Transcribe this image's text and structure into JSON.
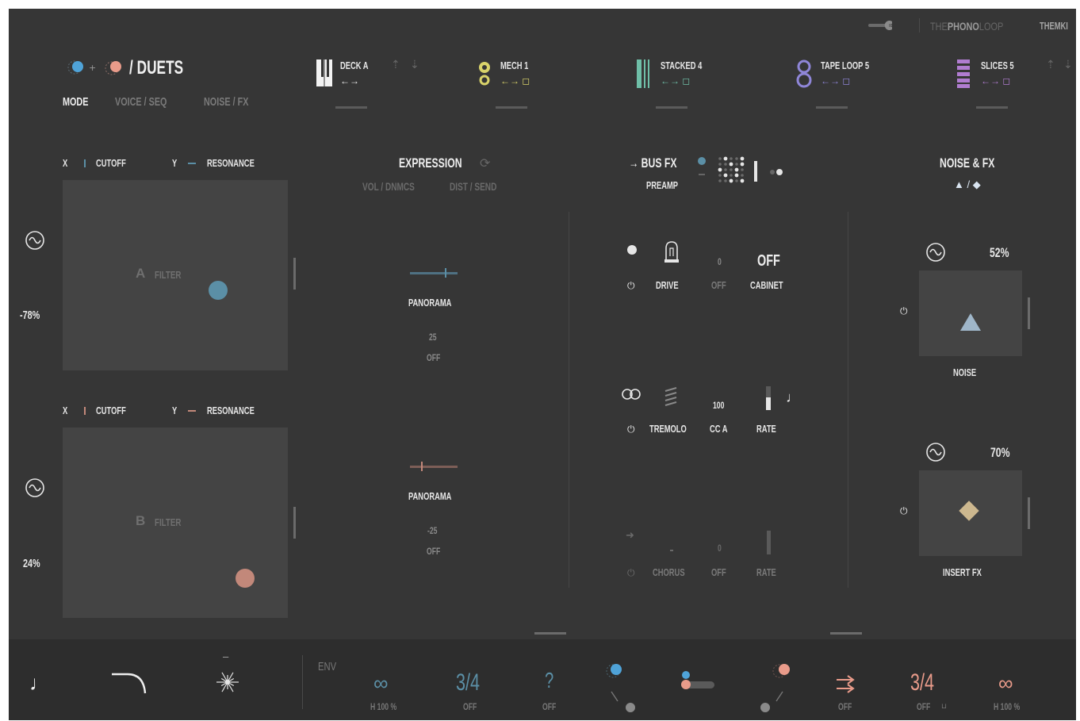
{
  "brand": {
    "wrench_icon": "wrench-icon",
    "name_the": "THE",
    "name_phono": "PHONO",
    "name_loop": "LOOP",
    "name_user": "THEMKI"
  },
  "colors": {
    "blue": "#5b8fa6",
    "salmon": "#c2887a",
    "yellow": "#d9d36a",
    "teal": "#6fbfa8",
    "purple": "#b07cd0",
    "lavender": "#8f86d8",
    "bg": "#363636"
  },
  "header": {
    "title": "/ DUETS",
    "tabs": [
      {
        "label": "MODE",
        "active": true
      },
      {
        "label": "VOICE / SEQ",
        "active": false
      },
      {
        "label": "NOISE / FX",
        "active": false
      }
    ]
  },
  "decks": [
    {
      "name": "DECK A",
      "icon": "piano-icon"
    },
    {
      "name": "MECH 1",
      "icon": "gear-icon"
    },
    {
      "name": "STACKED 4",
      "icon": "bars-icon"
    },
    {
      "name": "TAPE LOOP 5",
      "icon": "tape-loop-icon"
    },
    {
      "name": "SLICES 5",
      "icon": "slices-icon"
    }
  ],
  "pads": [
    {
      "x_label": "X",
      "x_param": "CUTOFF",
      "y_label": "Y",
      "y_param": "RESONANCE",
      "letter": "A",
      "name": "FILTER",
      "lfo_value": "-78%"
    },
    {
      "x_label": "X",
      "x_param": "CUTOFF",
      "y_label": "Y",
      "y_param": "RESONANCE",
      "letter": "B",
      "name": "FILTER",
      "lfo_value": "24%"
    }
  ],
  "expression": {
    "title": "EXPRESSION",
    "sub_left": "VOL / DNMCS",
    "sub_right": "DIST / SEND",
    "voices": [
      {
        "label": "PANORAMA",
        "value": "25",
        "state": "OFF"
      },
      {
        "label": "PANORAMA",
        "value": "-25",
        "state": "OFF"
      }
    ]
  },
  "busfx": {
    "title": "→ BUS FX",
    "sub": "PREAMP",
    "rows": [
      {
        "name": "DRIVE",
        "value": "0",
        "value_state": "OFF",
        "extra_value": "OFF",
        "extra_label": "CABINET"
      },
      {
        "name": "TREMOLO",
        "value": "100",
        "value_state": "CC A",
        "extra_label": "RATE"
      },
      {
        "name": "CHORUS",
        "value": "0",
        "value_state": "OFF",
        "extra_label": "RATE"
      }
    ]
  },
  "noisefx": {
    "title": "NOISE & FX",
    "sub": "▲ / ◆",
    "units": [
      {
        "label": "NOISE",
        "value": "52%",
        "level": 0.52
      },
      {
        "label": "INSERT FX",
        "value": "70%",
        "level": 0.7
      }
    ]
  },
  "bottom": {
    "env_label": "ENV",
    "left_loop": {
      "symbol": "∞",
      "caption": "H  100 %"
    },
    "left_sig": {
      "value": "3/4",
      "caption": "OFF"
    },
    "question": {
      "symbol": "?",
      "caption": "OFF"
    },
    "right_arrows_caption": "OFF",
    "right_sig": {
      "value": "3/4",
      "caption": "OFF"
    },
    "right_loop": {
      "symbol": "∞",
      "caption": "H  100 %"
    },
    "minus": "–"
  }
}
